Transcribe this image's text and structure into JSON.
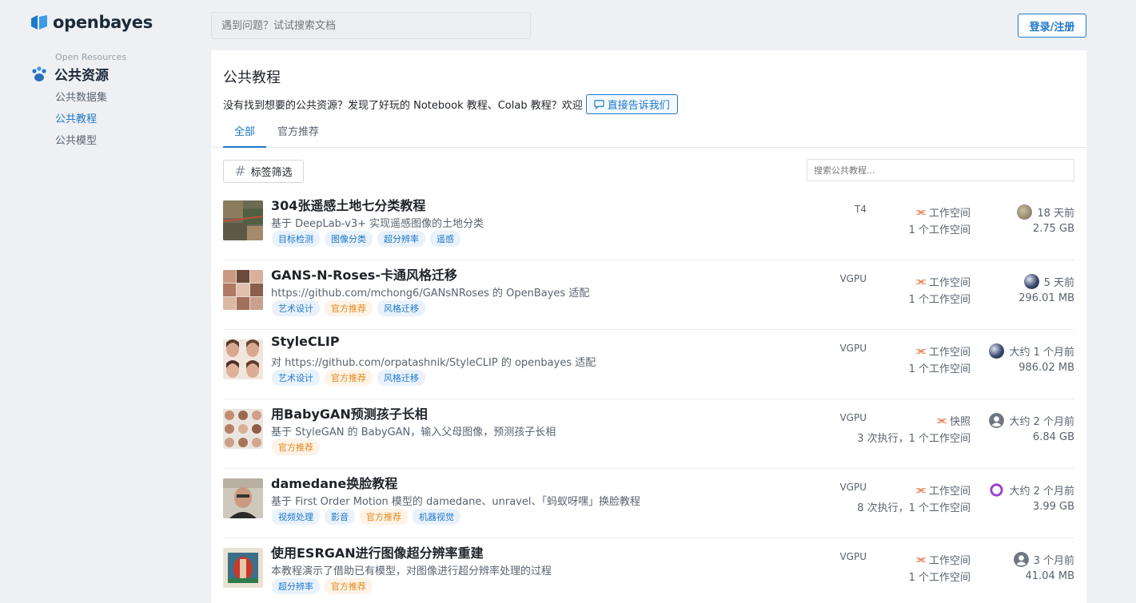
{
  "brand": {
    "name": "openbayes"
  },
  "header": {
    "search_placeholder": "遇到问题？试试搜索文档",
    "login_label": "登录/注册"
  },
  "sidebar": {
    "subtitle": "Open Resources",
    "title": "公共资源",
    "items": [
      {
        "label": "公共数据集",
        "active": false
      },
      {
        "label": "公共教程",
        "active": true
      },
      {
        "label": "公共模型",
        "active": false
      }
    ]
  },
  "main": {
    "title": "公共教程",
    "description": "没有找到想要的公共资源？发现了好玩的 Notebook 教程、Colab 教程？欢迎",
    "tell_us_label": "直接告诉我们",
    "tabs": [
      {
        "label": "全部",
        "active": true
      },
      {
        "label": "官方推荐",
        "active": false
      }
    ],
    "filter_label": "标签筛选",
    "list_search_placeholder": "搜索公共教程..."
  },
  "rows": [
    {
      "title": "304张遥感土地七分类教程",
      "description": "基于 DeepLab-v3+ 实现遥感图像的土地分类",
      "tags": [
        {
          "label": "目标检测",
          "color": "blue"
        },
        {
          "label": "图像分类",
          "color": "blue"
        },
        {
          "label": "超分辨率",
          "color": "blue"
        },
        {
          "label": "遥感",
          "color": "blue"
        }
      ],
      "gpu": "T4",
      "workspace_label": "工作空间",
      "workspace_count": "1 个工作空间",
      "time": "18 天前",
      "size": "2.75 GB",
      "avatar": "photo"
    },
    {
      "title": "GANS-N-Roses-卡通风格迁移",
      "description": "https://github.com/mchong6/GANsNRoses 的 OpenBayes 适配",
      "tags": [
        {
          "label": "艺术设计",
          "color": "blue"
        },
        {
          "label": "官方推荐",
          "color": "orange"
        },
        {
          "label": "风格迁移",
          "color": "blue"
        }
      ],
      "gpu": "VGPU",
      "workspace_label": "工作空间",
      "workspace_count": "1 个工作空间",
      "time": "5 天前",
      "size": "296.01 MB",
      "avatar": "planet"
    },
    {
      "title": "StyleCLIP",
      "description": "对 https://github.com/orpatashnik/StyleCLIP 的 openbayes 适配",
      "tags": [
        {
          "label": "艺术设计",
          "color": "blue"
        },
        {
          "label": "官方推荐",
          "color": "orange"
        },
        {
          "label": "风格迁移",
          "color": "blue"
        }
      ],
      "gpu": "VGPU",
      "workspace_label": "工作空间",
      "workspace_count": "1 个工作空间",
      "time": "大约 1 个月前",
      "size": "986.02 MB",
      "avatar": "planet"
    },
    {
      "title": "用BabyGAN预测孩子长相",
      "description": "基于 StyleGAN 的 BabyGAN，输入父母图像，预测孩子长相",
      "tags": [
        {
          "label": "官方推荐",
          "color": "orange"
        }
      ],
      "gpu": "VGPU",
      "workspace_label": "快照",
      "workspace_count": "3 次执行，1 个工作空间",
      "time": "大约 2 个月前",
      "size": "6.84 GB",
      "avatar": "user"
    },
    {
      "title": "damedane换脸教程",
      "description": "基于 First Order Motion 模型的 damedane、unravel、「蚂蚁呀嘿」换脸教程",
      "tags": [
        {
          "label": "视频处理",
          "color": "blue"
        },
        {
          "label": "影音",
          "color": "blue"
        },
        {
          "label": "官方推荐",
          "color": "orange"
        },
        {
          "label": "机器视觉",
          "color": "blue"
        }
      ],
      "gpu": "VGPU",
      "workspace_label": "工作空间",
      "workspace_count": "8 次执行，1 个工作空间",
      "time": "大约 2 个月前",
      "size": "3.99 GB",
      "avatar": "ring"
    },
    {
      "title": "使用ESRGAN进行图像超分辨率重建",
      "description": "本教程演示了借助已有模型，对图像进行超分辨率处理的过程",
      "tags": [
        {
          "label": "超分辨率",
          "color": "blue"
        },
        {
          "label": "官方推荐",
          "color": "orange"
        }
      ],
      "gpu": "VGPU",
      "workspace_label": "工作空间",
      "workspace_count": "1 个工作空间",
      "time": "3 个月前",
      "size": "41.04 MB",
      "avatar": "user"
    }
  ]
}
